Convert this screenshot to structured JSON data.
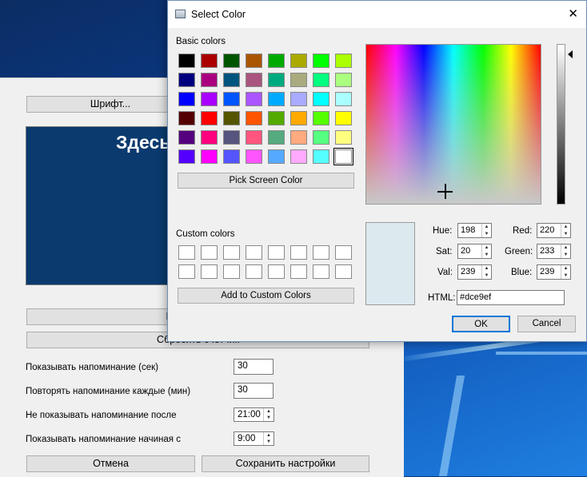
{
  "settings": {
    "font_button": "Шрифт...",
    "preview_text": "Здесь",
    "restore_button": "Восстановить",
    "reset_counter_button": "Сбросить счетчик",
    "rows": [
      {
        "label": "Показывать напоминание (сек)",
        "value": "30"
      },
      {
        "label": "Повторять напоминание каждые (мин)",
        "value": "30"
      },
      {
        "label": "Не показывать напоминание после",
        "value": "21:00"
      },
      {
        "label": "Показывать напоминание начиная с",
        "value": "9:00"
      }
    ],
    "cancel_button": "Отмена",
    "save_button": "Сохранить настройки",
    "preview_bg": "#0a3a6e"
  },
  "dialog": {
    "title": "Select Color",
    "basic_colors_label": "Basic colors",
    "basic_colors": [
      [
        "#000000",
        "#aa0000",
        "#005500",
        "#aa5500",
        "#00aa00",
        "#aaaa00",
        "#00ff00",
        "#aaff00"
      ],
      [
        "#00007f",
        "#aa007f",
        "#00557f",
        "#aa557f",
        "#00aa7f",
        "#aaaa7f",
        "#00ff7f",
        "#aaff7f"
      ],
      [
        "#0000ff",
        "#aa00ff",
        "#0055ff",
        "#aa55ff",
        "#00aaff",
        "#aaaaff",
        "#00ffff",
        "#aaffff"
      ],
      [
        "#550000",
        "#ff0000",
        "#555500",
        "#ff5500",
        "#55aa00",
        "#ffaa00",
        "#55ff00",
        "#ffff00"
      ],
      [
        "#55007f",
        "#ff007f",
        "#55557f",
        "#ff557f",
        "#55aa7f",
        "#ffaa7f",
        "#55ff7f",
        "#ffff7f"
      ],
      [
        "#5500ff",
        "#ff00ff",
        "#5555ff",
        "#ff55ff",
        "#55aaff",
        "#ffaaff",
        "#55ffff",
        "#ffffff"
      ]
    ],
    "pick_screen_button": "Pick Screen Color",
    "custom_colors_label": "Custom colors",
    "add_custom_button": "Add to Custom Colors",
    "hue_label": "Hue:",
    "hue": "198",
    "sat_label": "Sat:",
    "sat": "20",
    "val_label": "Val:",
    "val": "239",
    "red_label": "Red:",
    "red": "220",
    "green_label": "Green:",
    "green": "233",
    "blue_label": "Blue:",
    "blue": "239",
    "html_label": "HTML:",
    "html": "#dce9ef",
    "current_color": "#dce9ef",
    "ok_button": "OK",
    "cancel_button": "Cancel",
    "close_glyph": "✕"
  }
}
